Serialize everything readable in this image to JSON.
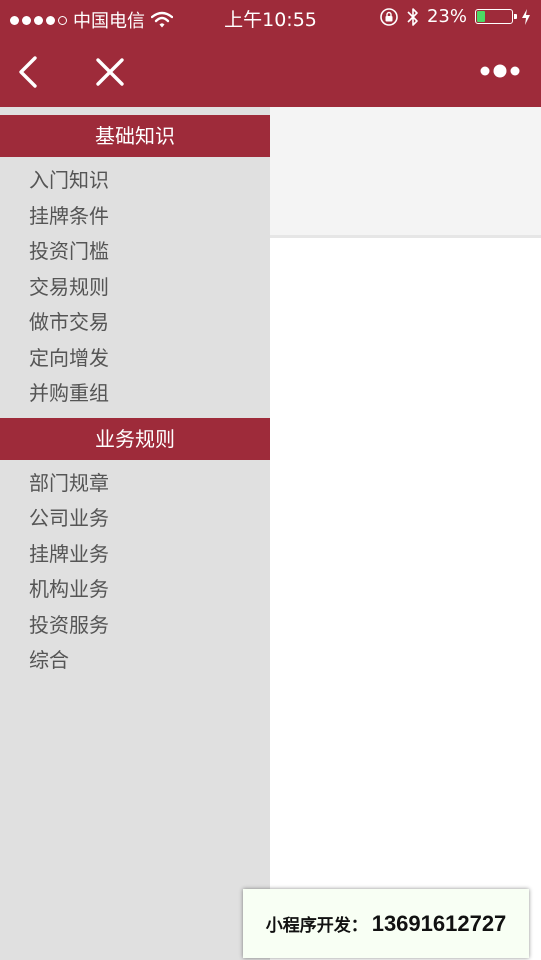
{
  "status_bar": {
    "carrier": "中国电信",
    "time": "上午10:55",
    "battery_percent": "23%",
    "battery_level": 0.23
  },
  "nav": {
    "back_icon": "chevron-left-icon",
    "close_icon": "close-icon",
    "more_icon": "more-dots-icon"
  },
  "sidebar": {
    "categories": [
      {
        "title": "基础知识",
        "items": [
          "入门知识",
          "挂牌条件",
          "投资门槛",
          "交易规则",
          "做市交易",
          "定向增发",
          "并购重组"
        ]
      },
      {
        "title": "业务规则",
        "items": [
          "部门规章",
          "公司业务",
          "挂牌业务",
          "机构业务",
          "投资服务",
          "综合"
        ]
      }
    ]
  },
  "footer_ad": {
    "label": "小程序开发：",
    "number": "13691612727"
  },
  "colors": {
    "accent": "#9e2b3a",
    "sidebar_bg": "#e0e0e0",
    "battery_green": "#4cd964"
  }
}
